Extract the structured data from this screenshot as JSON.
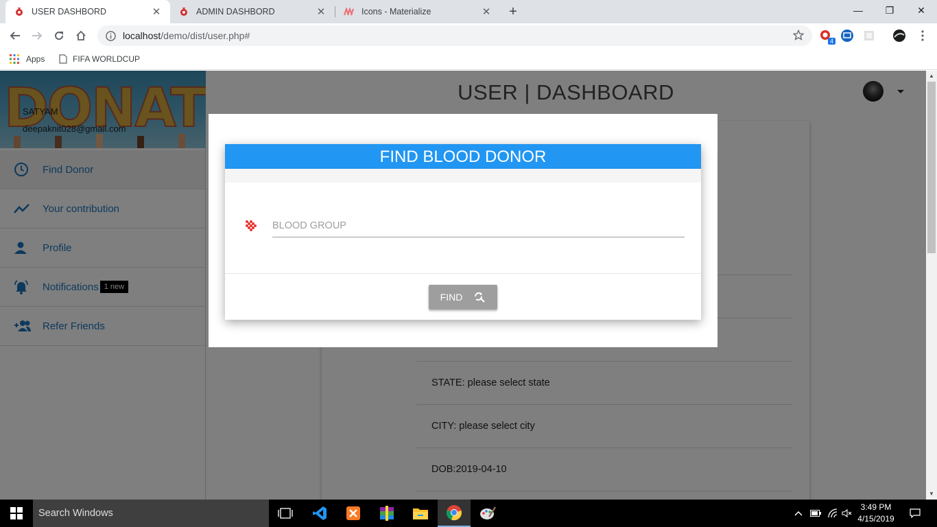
{
  "browser": {
    "tabs": [
      {
        "title": "USER DASHBORD",
        "active": true
      },
      {
        "title": "ADMIN DASHBORD",
        "active": false
      },
      {
        "title": "Icons - Materialize",
        "active": false
      }
    ],
    "url_host": "localhost",
    "url_path": "/demo/dist/user.php#",
    "extension_badge": "4",
    "bookmarks": [
      {
        "label": "Apps",
        "icon": "apps-grid-icon"
      },
      {
        "label": "FIFA WORLDCUP",
        "icon": "page-icon"
      }
    ]
  },
  "sidebar": {
    "banner_text": "DONATE",
    "user_name": "SATYAM",
    "user_email": "deepaknit028@gmail.com",
    "items": [
      {
        "label": "Find Donor",
        "icon": "clock-icon"
      },
      {
        "label": "Your contribution",
        "icon": "trending-icon"
      },
      {
        "label": "Profile",
        "icon": "person-icon"
      },
      {
        "label": "Notifications",
        "icon": "bell-icon",
        "badge": "1 new"
      },
      {
        "label": "Refer Friends",
        "icon": "group-add-icon"
      }
    ]
  },
  "header": {
    "title": "USER | DASHBOARD"
  },
  "profile": {
    "rows": [
      "STATE: please select state",
      "CITY: please select city",
      "DOB:2019-04-10"
    ]
  },
  "modal": {
    "title": "FIND BLOOD DONOR",
    "field_placeholder": "BLOOD GROUP",
    "button_label": "FIND"
  },
  "taskbar": {
    "search_placeholder": "Search Windows",
    "time": "3:49 PM",
    "date": "4/15/2019"
  },
  "colors": {
    "accent_blue": "#2196f3",
    "link_blue": "#1b72b8",
    "button_gray": "#9e9e9e",
    "icon_red": "#e53935"
  }
}
